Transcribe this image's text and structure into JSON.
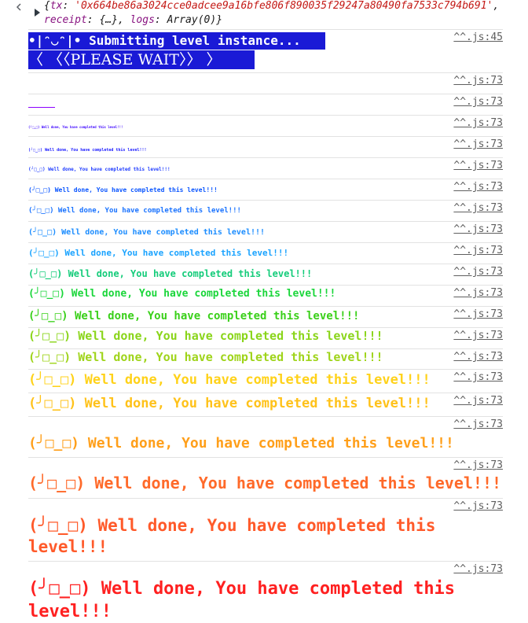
{
  "object": {
    "open": "{",
    "tx_key": "tx",
    "tx_value": "'0x664be86a3024cce0adcee9a16bfe806f890035f29247a80490fa7533c794b691'",
    "receipt_key": "receipt",
    "receipt_value": "{…}",
    "logs_key": "logs",
    "logs_value": "Array(0)",
    "close": "}"
  },
  "banner": {
    "line1": "•|ᵔ◡ᵔ|• Submitting level instance...",
    "line2": "〈 〈〈PLEASE WAIT〉〉 〉"
  },
  "sources": {
    "first": "^^.js:45",
    "rest": "^^.js:73"
  },
  "message": "(╯□_□) Well done, You have completed this level!!!",
  "rows": [
    {
      "color": "#e01010",
      "size": "empty"
    },
    {
      "color": "#8b00ff",
      "size": "line"
    },
    {
      "color": "#3a00ff",
      "size": "1"
    },
    {
      "color": "#1a1aff",
      "size": "4"
    },
    {
      "color": "#1f3cff",
      "size": "6"
    },
    {
      "color": "#0b56ff",
      "size": "8"
    },
    {
      "color": "#1a73ff",
      "size": "9"
    },
    {
      "color": "#1a8cff",
      "size": "10"
    },
    {
      "color": "#1aa3ff",
      "size": "11"
    },
    {
      "color": "#14cc7a",
      "size": "12"
    },
    {
      "color": "#1ad63a",
      "size": "13"
    },
    {
      "color": "#3ad01a",
      "size": "14"
    },
    {
      "color": "#8ad51a",
      "size": "15"
    },
    {
      "color": "#9fd41a",
      "size": "15"
    },
    {
      "color": "#ffd21a",
      "size": "17"
    },
    {
      "color": "#ffc21a",
      "size": "17"
    },
    {
      "color": "#ff9f1a",
      "size": "18"
    },
    {
      "color": "#ff6a2a",
      "size": "20"
    },
    {
      "color": "#ff5a2a",
      "size": "21"
    },
    {
      "color": "#ff2020",
      "size": "22"
    }
  ]
}
